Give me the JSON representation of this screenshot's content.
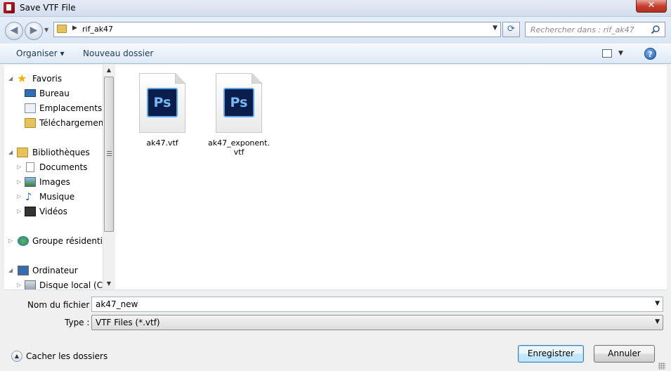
{
  "window": {
    "title": "Save VTF File",
    "close_glyph": "✕"
  },
  "nav": {
    "back_glyph": "◀",
    "forward_glyph": "▶",
    "breadcrumb": [
      "rif_ak47"
    ],
    "search_placeholder": "Rechercher dans : rif_ak47"
  },
  "toolbar": {
    "organiser": "Organiser ▾",
    "new_folder": "Nouveau dossier",
    "help": "?"
  },
  "tree": {
    "favoris": "Favoris",
    "bureau": "Bureau",
    "emplacements": "Emplacements récents",
    "telechargements": "Téléchargements",
    "bibliotheques": "Bibliothèques",
    "documents": "Documents",
    "images": "Images",
    "musique": "Musique",
    "videos": "Vidéos",
    "groupe": "Groupe résidentiel",
    "ordinateur": "Ordinateur",
    "disque": "Disque local (C:)"
  },
  "files": [
    {
      "name": "ak47.vtf",
      "icon": "photoshop-file-icon",
      "icon_text": "Ps"
    },
    {
      "name": "ak47_exponent.vtf",
      "icon": "photoshop-file-icon",
      "icon_text": "Ps"
    }
  ],
  "form": {
    "filename_label": "Nom du fichier :",
    "filename_value": "ak47_new",
    "type_label": "Type :",
    "type_value": "VTF Files (*.vtf)",
    "hide_folders": "Cacher les dossiers",
    "save_button": "Enregistrer",
    "cancel_button": "Annuler"
  },
  "colors": {
    "accent": "#3c7fb1",
    "close_red": "#c7402d",
    "ps_blue": "#5ea4e8"
  }
}
